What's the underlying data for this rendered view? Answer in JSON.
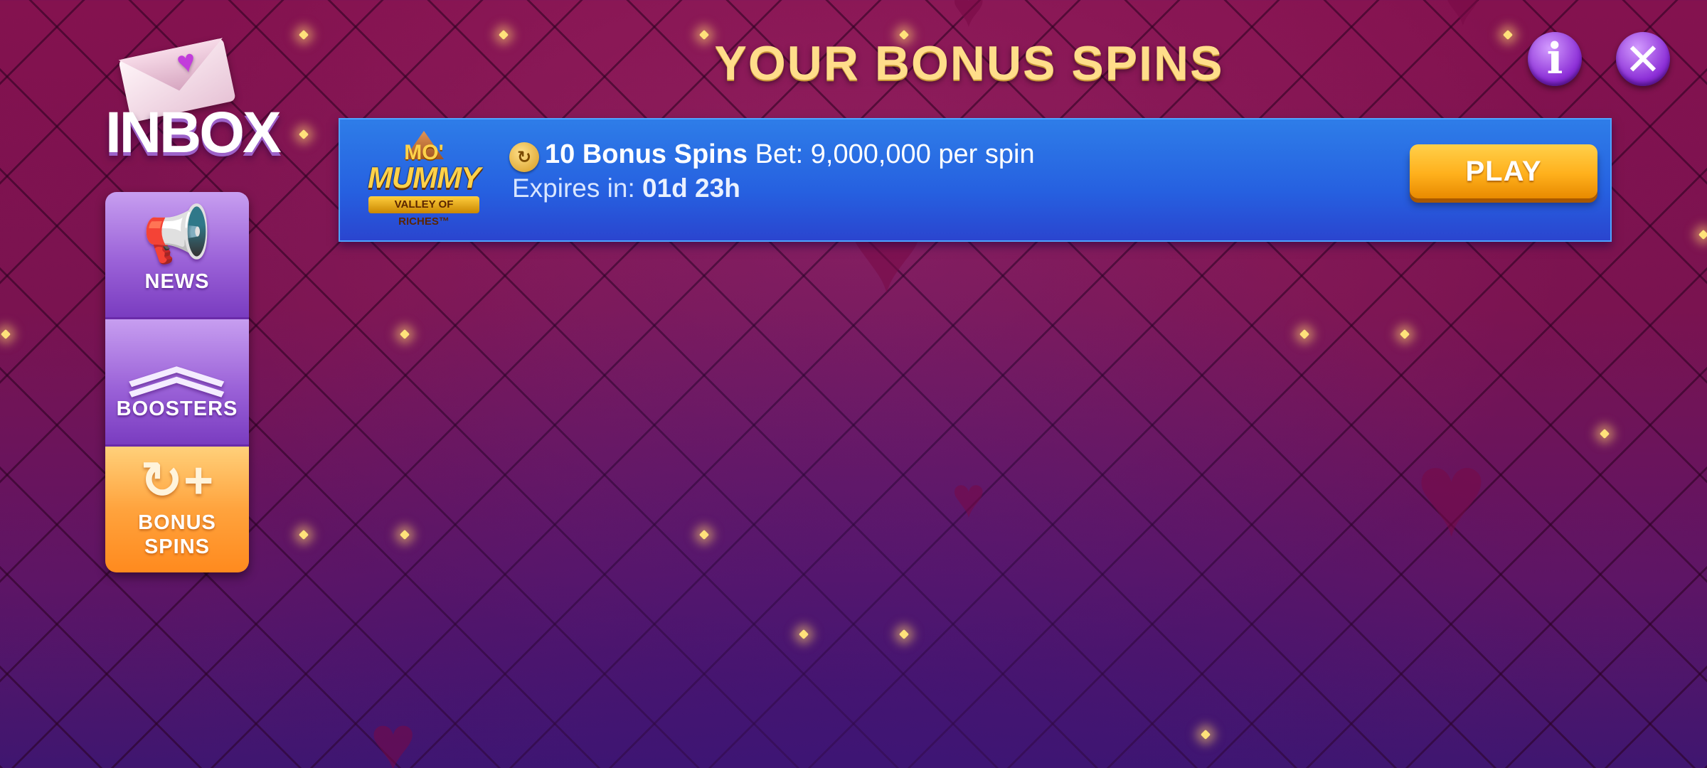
{
  "header": {
    "logo_text": "INBOX",
    "title": "YOUR BONUS SPINS",
    "info_label": "i",
    "close_label": "✕"
  },
  "sidebar": {
    "items": [
      {
        "label": "NEWS",
        "icon": "megaphone-icon",
        "glyph": "📢",
        "selected": false
      },
      {
        "label": "BOOSTERS",
        "icon": "double-chevron-up-icon",
        "glyph": "︽",
        "selected": false
      },
      {
        "label": "BONUS\nSPINS",
        "icon": "spin-plus-icon",
        "glyph": "↻+",
        "selected": true
      }
    ]
  },
  "bonus": {
    "game_logo": {
      "mo": "MO'",
      "name": "MUMMY",
      "subtitle": "VALLEY OF RICHES™"
    },
    "spins_count": "10 Bonus Spins",
    "bet_text": "Bet: 9,000,000 per spin",
    "expires_label": "Expires in:",
    "expires_value": "01d 23h",
    "play_label": "PLAY"
  },
  "colors": {
    "background": "#84124f",
    "title_gold": "#ffdd8a",
    "card_blue": "#2660e0",
    "play_orange": "#ffb01c",
    "nav_purple": "#9b62d8",
    "nav_selected_orange": "#ffa33d"
  }
}
